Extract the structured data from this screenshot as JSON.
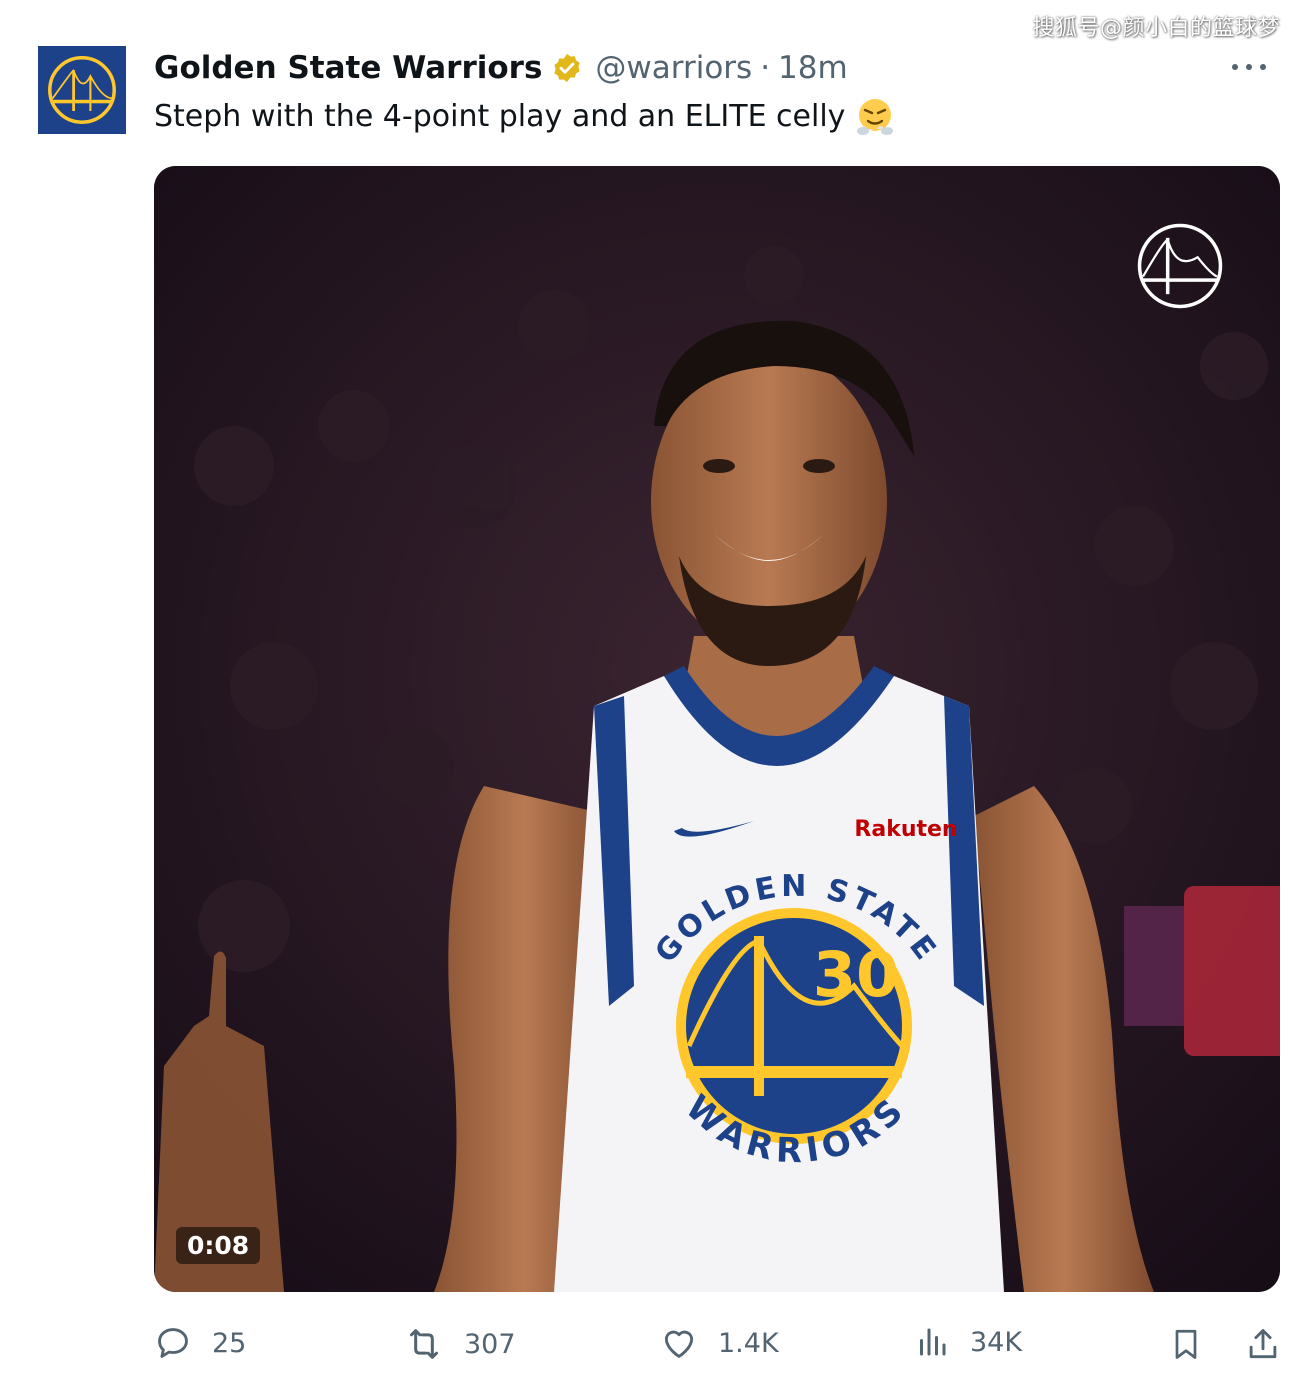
{
  "watermark": "搜狐号@颜小白的篮球梦",
  "tweet": {
    "display_name": "Golden State Warriors",
    "handle": "@warriors",
    "separator": "·",
    "time": "18m",
    "text": "Steph with the 4-point play and an ELITE celly",
    "media": {
      "duration": "0:08",
      "jersey": {
        "sponsor": "Rakuten",
        "top_text": "GOLDEN STATE",
        "bottom_text": "WARRIORS",
        "number": "30"
      }
    }
  },
  "actions": {
    "replies": "25",
    "reposts": "307",
    "likes": "1.4K",
    "views": "34K"
  },
  "icons": [
    "warriors-logo-icon",
    "verified-badge-icon",
    "more-icon",
    "steam-emoji-icon",
    "reply-icon",
    "repost-icon",
    "like-icon",
    "views-icon",
    "bookmark-icon",
    "share-icon"
  ],
  "colors": {
    "warriors_blue": "#1d428a",
    "warriors_gold": "#ffc72c",
    "verified_gold": "#e2b719",
    "secondary_text": "#536471",
    "primary_text": "#0f1419"
  }
}
